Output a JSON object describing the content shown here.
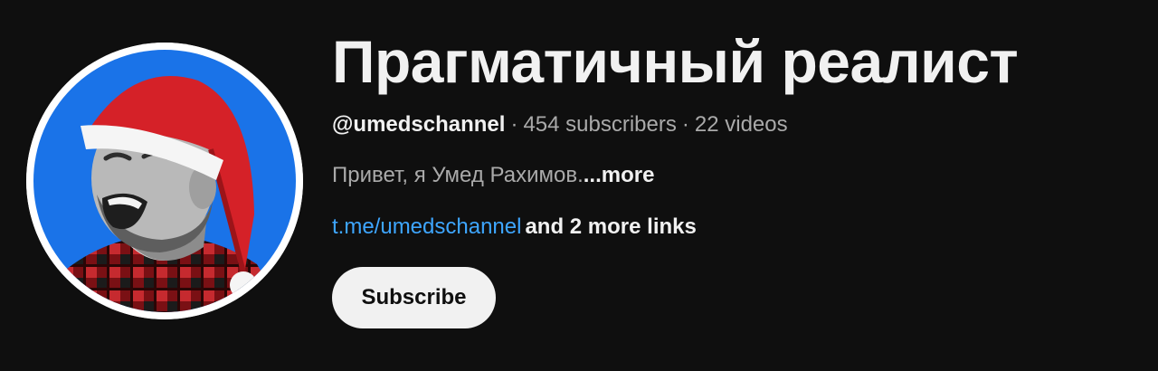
{
  "channel": {
    "title": "Прагматичный реалист",
    "handle": "@umedschannel",
    "separator": "·",
    "subscribers": "454 subscribers",
    "videos": "22 videos",
    "description": "Привет, я Умед Рахимов.",
    "description_more": "...more",
    "primary_link": "t.me/umedschannel",
    "more_links": "and 2 more links",
    "subscribe_label": "Subscribe"
  },
  "avatar": {
    "icon": "channel-avatar-santa-hat-portrait",
    "background_color": "#1a73e8",
    "hat_color": "#d52128"
  },
  "colors": {
    "page_background": "#0f0f0f",
    "link": "#3ea6ff",
    "button_background": "#f1f1f1",
    "secondary_text": "#aaaaaa"
  }
}
